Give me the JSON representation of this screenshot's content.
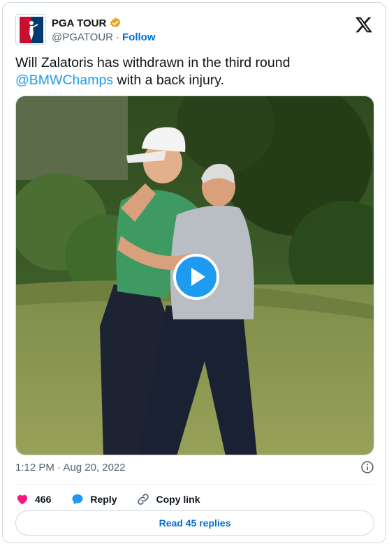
{
  "author": {
    "display_name": "PGA TOUR",
    "handle": "@PGATOUR",
    "follow_label": "Follow",
    "verified": true,
    "verified_color": "#e8a317",
    "logo_icon": "pga-tour-logo"
  },
  "tweet": {
    "text_line1": "Will Zalatoris has withdrawn in the third round",
    "mention": "@BMWChamps",
    "text_line2_rest": " with a back injury.",
    "media_type": "video",
    "timestamp": "1:12 PM · Aug 20, 2022"
  },
  "actions": {
    "like_count": "466",
    "reply_label": "Reply",
    "copy_link_label": "Copy link",
    "read_replies_label": "Read 45 replies"
  },
  "colors": {
    "accent": "#1d9bf0",
    "like": "#f91880",
    "text_secondary": "#536471"
  }
}
